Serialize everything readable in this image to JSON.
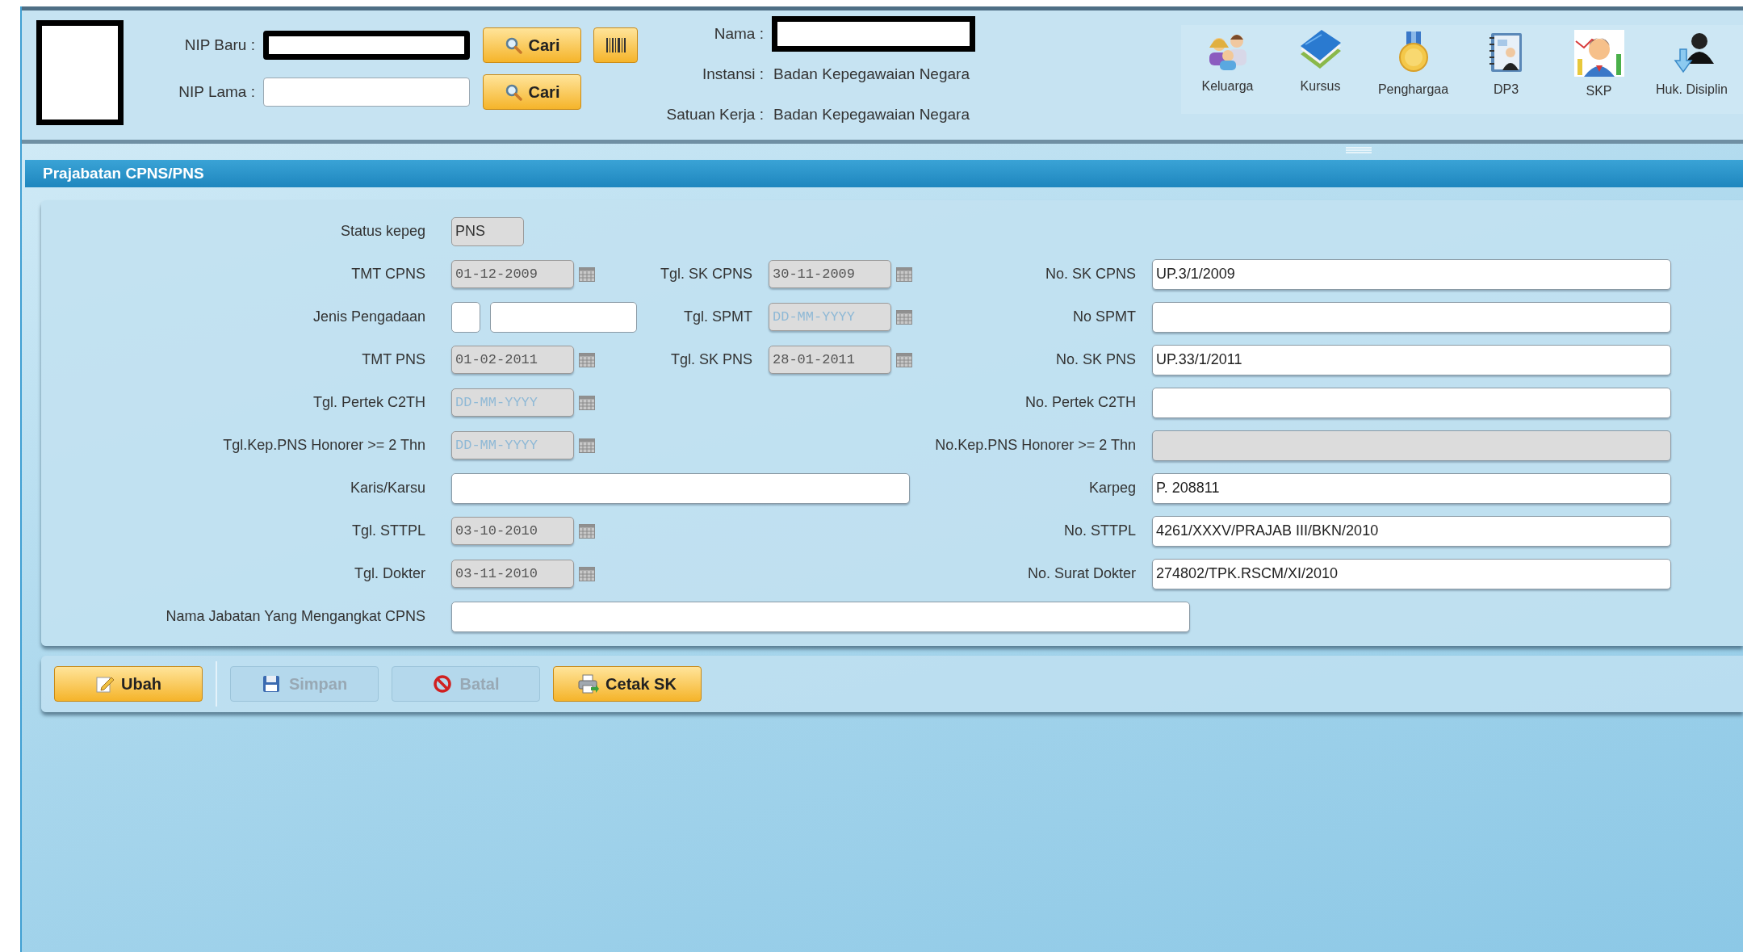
{
  "header": {
    "search_rows": [
      {
        "label": "NIP Baru :",
        "redacted": true,
        "button": "Cari",
        "barcode": true
      },
      {
        "label": "NIP Lama :",
        "redacted": false,
        "button": "Cari",
        "barcode": false
      }
    ],
    "info": [
      {
        "label": "Nama :",
        "kind": "redacted"
      },
      {
        "label": "Instansi :",
        "kind": "text",
        "value": "Badan Kepegawaian Negara"
      },
      {
        "label": "Satuan Kerja :",
        "kind": "text",
        "value": "Badan Kepegawaian Negara"
      }
    ],
    "shortcuts": [
      {
        "label": "Keluarga"
      },
      {
        "label": "Kursus"
      },
      {
        "label": "Penghargaa"
      },
      {
        "label": "DP3"
      },
      {
        "label": "SKP"
      },
      {
        "label": "Huk. Disiplin"
      }
    ]
  },
  "section": {
    "title": "Prajabatan CPNS/PNS"
  },
  "form": {
    "rows": [
      {
        "left": {
          "label": "Status kepeg",
          "kind": "short",
          "value": "PNS"
        }
      },
      {
        "left": {
          "label": "TMT CPNS",
          "kind": "date",
          "value": "01-12-2009"
        },
        "middle": {
          "label": "Tgl. SK CPNS",
          "kind": "date",
          "value": "30-11-2009"
        },
        "right": {
          "label": "No. SK CPNS",
          "kind": "text",
          "value": "UP.3/1/2009",
          "disabled": false
        }
      },
      {
        "left": {
          "label": "Jenis Pengadaan",
          "kind": "combo"
        },
        "middle": {
          "label": "Tgl. SPMT",
          "kind": "date",
          "placeholder": "DD-MM-YYYY"
        },
        "right": {
          "label": "No SPMT",
          "kind": "text",
          "disabled": false
        }
      },
      {
        "left": {
          "label": "TMT PNS",
          "kind": "date",
          "value": "01-02-2011"
        },
        "middle": {
          "label": "Tgl. SK PNS",
          "kind": "date",
          "value": "28-01-2011"
        },
        "right": {
          "label": "No. SK PNS",
          "kind": "text",
          "value": "UP.33/1/2011",
          "disabled": false
        }
      },
      {
        "left": {
          "label": "Tgl. Pertek C2TH",
          "kind": "date",
          "placeholder": "DD-MM-YYYY"
        },
        "right": {
          "label": "No. Pertek C2TH",
          "kind": "text",
          "disabled": false
        }
      },
      {
        "left": {
          "label": "Tgl.Kep.PNS Honorer >= 2 Thn",
          "kind": "date",
          "placeholder": "DD-MM-YYYY"
        },
        "right": {
          "label": "No.Kep.PNS Honorer >= 2 Thn",
          "kind": "text",
          "disabled": true
        }
      },
      {
        "left": {
          "label": "Karis/Karsu",
          "kind": "wide",
          "disabled": false
        },
        "right": {
          "label": "Karpeg",
          "kind": "text",
          "value": "P. 208811",
          "disabled": false
        }
      },
      {
        "left": {
          "label": "Tgl. STTPL",
          "kind": "date",
          "value": "03-10-2010"
        },
        "right": {
          "label": "No. STTPL",
          "kind": "text",
          "value": "4261/XXXV/PRAJAB III/BKN/2010",
          "disabled": false
        }
      },
      {
        "left": {
          "label": "Tgl. Dokter",
          "kind": "date",
          "value": "03-11-2010"
        },
        "right": {
          "label": "No. Surat Dokter",
          "kind": "text",
          "value": "274802/TPK.RSCM/XI/2010",
          "disabled": false
        }
      },
      {
        "left": {
          "label": "Nama Jabatan Yang Mengangkat CPNS",
          "kind": "full",
          "disabled": false
        }
      }
    ]
  },
  "actions": [
    {
      "label": "Ubah",
      "disabled": false
    },
    {
      "label": "Simpan",
      "disabled": true
    },
    {
      "label": "Batal",
      "disabled": true
    },
    {
      "label": "Cetak SK",
      "disabled": false
    }
  ]
}
